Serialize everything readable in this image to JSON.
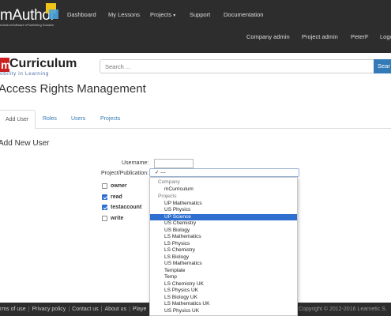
{
  "app": {
    "logo_text": "mAuthor",
    "logo_sub": "mAuthorSoftware ePublishing Solution"
  },
  "nav": {
    "primary": [
      {
        "label": "Dashboard"
      },
      {
        "label": "My Lessons"
      },
      {
        "label": "Projects"
      },
      {
        "label": "Support"
      },
      {
        "label": "Documentation"
      }
    ],
    "secondary": [
      {
        "label": "Company admin"
      },
      {
        "label": "Project admin"
      },
      {
        "label": "PeterF"
      },
      {
        "label": "Logo"
      }
    ]
  },
  "brand": {
    "m": "m",
    "name": "Curriculum",
    "tagline": "obility in Learning"
  },
  "search": {
    "placeholder": "Search ...",
    "button_label": "Sear"
  },
  "page": {
    "title": "Access Rights Management"
  },
  "tabs": [
    {
      "label": "Add User"
    },
    {
      "label": "Roles"
    },
    {
      "label": "Users"
    },
    {
      "label": "Projects"
    }
  ],
  "form": {
    "section_title": "Add New User",
    "username_label": "Username:",
    "project_label": "Project/Publication:",
    "project_value": "---",
    "permissions": [
      {
        "label": "owner",
        "checked": false
      },
      {
        "label": "read",
        "checked": true
      },
      {
        "label": "testaccount",
        "checked": true
      },
      {
        "label": "write",
        "checked": false
      }
    ]
  },
  "dropdown": {
    "company_group": "Company",
    "company_option": "mCurriculum",
    "projects_group": "Projects",
    "options": [
      "UP Mathematics",
      "US Physics",
      "UP Science",
      "US Chemistry",
      "US Biology",
      "LS Mathematics",
      "LS Physics",
      "LS Chemistry",
      "LS Biology",
      "US Mathematics",
      "Template",
      "Temp",
      "LS Chemistry UK",
      "LS Physics UK",
      "LS Biology UK",
      "LS Mathematics UK",
      "US Physics UK"
    ],
    "selected": "UP Science"
  },
  "footer": {
    "links": [
      "rms of use",
      "Privacy policy",
      "Contact us",
      "About us",
      "Playe"
    ],
    "copyright": "Copyright © 2012-2016 Learnetic S."
  },
  "colors": {
    "navbar": "#2d2d2d",
    "link": "#337ab7",
    "selected": "#2f6fd0",
    "brand_red": "#cc1f1f"
  }
}
